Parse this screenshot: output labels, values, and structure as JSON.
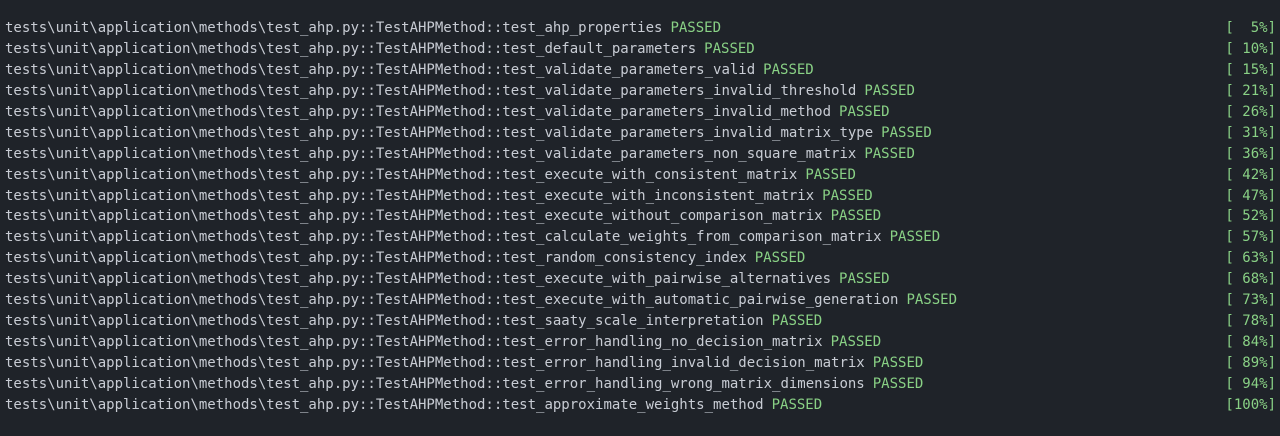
{
  "terminal": {
    "lines": [
      {
        "path": "tests\\unit\\application\\methods\\test_ahp.py::TestAHPMethod::test_ahp_properties",
        "status": "PASSED",
        "progress": "[  5%]"
      },
      {
        "path": "tests\\unit\\application\\methods\\test_ahp.py::TestAHPMethod::test_default_parameters",
        "status": "PASSED",
        "progress": "[ 10%]"
      },
      {
        "path": "tests\\unit\\application\\methods\\test_ahp.py::TestAHPMethod::test_validate_parameters_valid",
        "status": "PASSED",
        "progress": "[ 15%]"
      },
      {
        "path": "tests\\unit\\application\\methods\\test_ahp.py::TestAHPMethod::test_validate_parameters_invalid_threshold",
        "status": "PASSED",
        "progress": "[ 21%]"
      },
      {
        "path": "tests\\unit\\application\\methods\\test_ahp.py::TestAHPMethod::test_validate_parameters_invalid_method",
        "status": "PASSED",
        "progress": "[ 26%]"
      },
      {
        "path": "tests\\unit\\application\\methods\\test_ahp.py::TestAHPMethod::test_validate_parameters_invalid_matrix_type",
        "status": "PASSED",
        "progress": "[ 31%]"
      },
      {
        "path": "tests\\unit\\application\\methods\\test_ahp.py::TestAHPMethod::test_validate_parameters_non_square_matrix",
        "status": "PASSED",
        "progress": "[ 36%]"
      },
      {
        "path": "tests\\unit\\application\\methods\\test_ahp.py::TestAHPMethod::test_execute_with_consistent_matrix",
        "status": "PASSED",
        "progress": "[ 42%]"
      },
      {
        "path": "tests\\unit\\application\\methods\\test_ahp.py::TestAHPMethod::test_execute_with_inconsistent_matrix",
        "status": "PASSED",
        "progress": "[ 47%]"
      },
      {
        "path": "tests\\unit\\application\\methods\\test_ahp.py::TestAHPMethod::test_execute_without_comparison_matrix",
        "status": "PASSED",
        "progress": "[ 52%]"
      },
      {
        "path": "tests\\unit\\application\\methods\\test_ahp.py::TestAHPMethod::test_calculate_weights_from_comparison_matrix",
        "status": "PASSED",
        "progress": "[ 57%]"
      },
      {
        "path": "tests\\unit\\application\\methods\\test_ahp.py::TestAHPMethod::test_random_consistency_index",
        "status": "PASSED",
        "progress": "[ 63%]"
      },
      {
        "path": "tests\\unit\\application\\methods\\test_ahp.py::TestAHPMethod::test_execute_with_pairwise_alternatives",
        "status": "PASSED",
        "progress": "[ 68%]"
      },
      {
        "path": "tests\\unit\\application\\methods\\test_ahp.py::TestAHPMethod::test_execute_with_automatic_pairwise_generation",
        "status": "PASSED",
        "progress": "[ 73%]"
      },
      {
        "path": "tests\\unit\\application\\methods\\test_ahp.py::TestAHPMethod::test_saaty_scale_interpretation",
        "status": "PASSED",
        "progress": "[ 78%]"
      },
      {
        "path": "tests\\unit\\application\\methods\\test_ahp.py::TestAHPMethod::test_error_handling_no_decision_matrix",
        "status": "PASSED",
        "progress": "[ 84%]"
      },
      {
        "path": "tests\\unit\\application\\methods\\test_ahp.py::TestAHPMethod::test_error_handling_invalid_decision_matrix",
        "status": "PASSED",
        "progress": "[ 89%]"
      },
      {
        "path": "tests\\unit\\application\\methods\\test_ahp.py::TestAHPMethod::test_error_handling_wrong_matrix_dimensions",
        "status": "PASSED",
        "progress": "[ 94%]"
      },
      {
        "path": "tests\\unit\\application\\methods\\test_ahp.py::TestAHPMethod::test_approximate_weights_method",
        "status": "PASSED",
        "progress": "[100%]"
      }
    ]
  },
  "colors": {
    "background": "#1f2329",
    "text": "#c8ccd4",
    "passed": "#89d185"
  }
}
